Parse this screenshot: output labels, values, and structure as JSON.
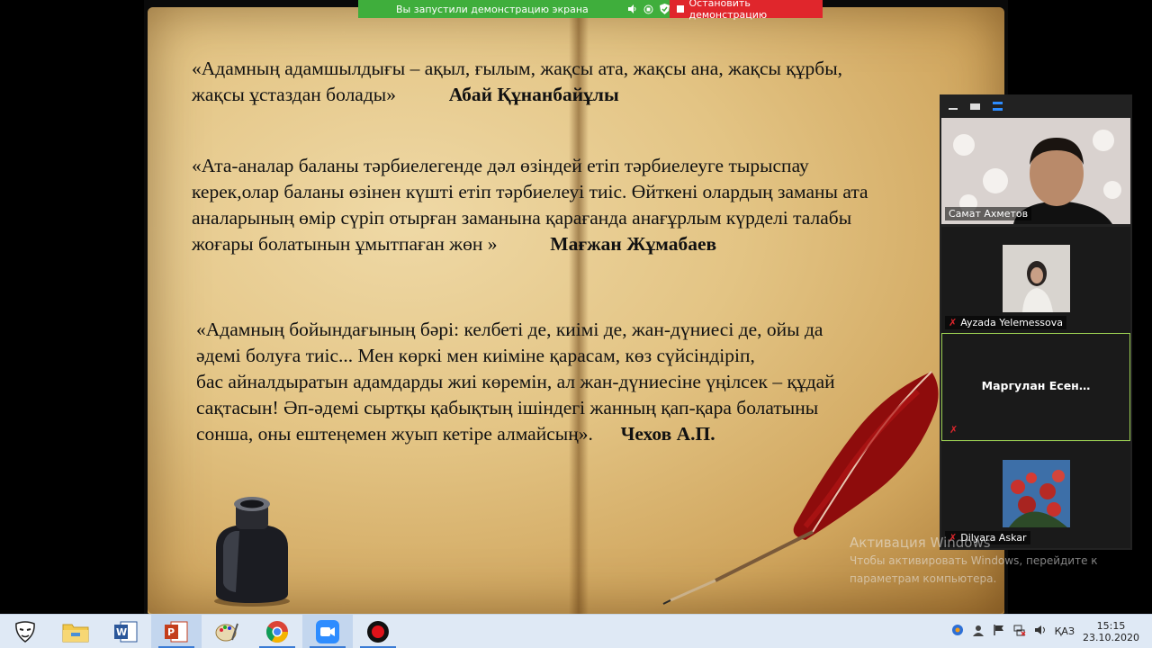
{
  "share_banner": {
    "status": "Вы запустили демонстрацию экрана",
    "stop_label": "Остановить демонстрацию"
  },
  "quotes": [
    {
      "lines": [
        "«Адамның адамшылдығы – ақыл, ғылым, жақсы ата, жақсы ана, жақсы құрбы,",
        "жақсы ұстаздан болады»"
      ],
      "author": "Абай Құнанбайұлы"
    },
    {
      "lines": [
        "«Ата-аналар баланы тәрбиелегенде дәл өзіндей етіп тәрбиелеуге тырыспау",
        "керек,олар баланы өзінен күшті етіп тәрбиелеуі тиіс. Өйткені олардың заманы ата",
        "аналарының өмір сүріп отырған заманына қарағанда анағұрлым күрделі талабы",
        "жоғары болатынын ұмытпаған жөн »"
      ],
      "author": "Мағжан Жұмабаев"
    },
    {
      "lines": [
        "«Адамның бойындағының бәрі: келбеті де, киімі де, жан-дүниесі де, ойы да",
        "әдемі болуға тиіс... Мен көркі мен киіміне қарасам, көз сүйсіндіріп,",
        "бас айналдыратын адамдарды жиі көремін, ал жан-дүниесіне үңілсек – құдай",
        "сақтасын! Әп-әдемі сыртқы қабықтың ішіндегі жанның қап-қара болатыны",
        "сонша, оны ештеңемен жуып кетіре алмайсың»."
      ],
      "author": "Чехов А.П."
    }
  ],
  "participants": [
    {
      "name": "Самат Ахметов",
      "muted": false
    },
    {
      "name": "Ayzada Yelemessova",
      "muted": true
    },
    {
      "name": "Маргулан  Есен…",
      "muted": true
    },
    {
      "name": "Dilyara Askar",
      "muted": true
    }
  ],
  "watermark": {
    "title": "Активация Windows",
    "line1": "Чтобы активировать Windows, перейдите к",
    "line2": "параметрам компьютера."
  },
  "taskbar": {
    "apps": [
      "anonymous-icon",
      "file-explorer-icon",
      "word-icon",
      "powerpoint-icon",
      "paint-icon",
      "chrome-icon",
      "zoom-icon",
      "record-icon"
    ],
    "language": "ҚАЗ",
    "time": "15:15",
    "date": "23.10.2020"
  },
  "colors": {
    "share_green": "#3fae3c",
    "stop_red": "#e0262c",
    "active_tile_border": "#9bcf52"
  }
}
